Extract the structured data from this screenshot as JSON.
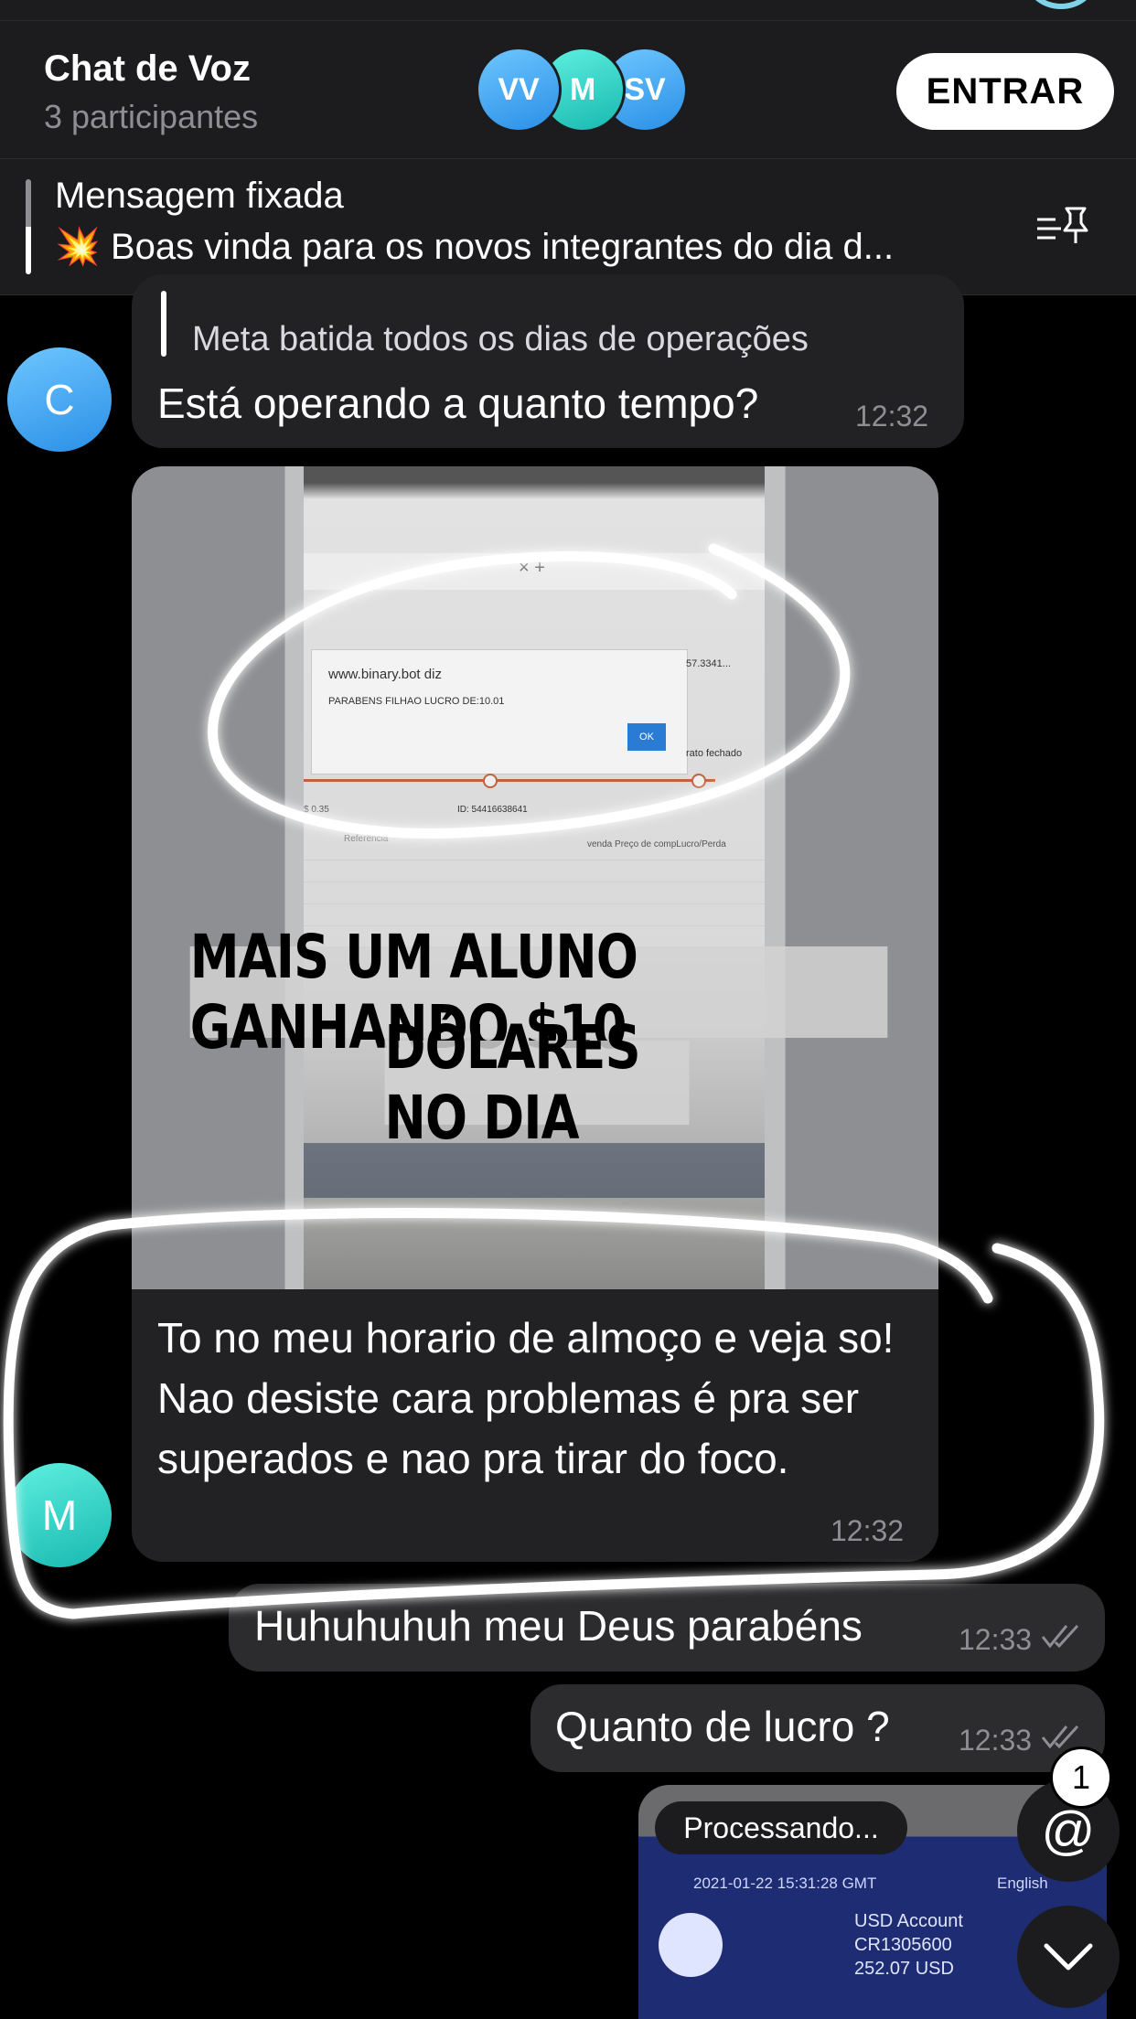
{
  "voice_chat": {
    "title": "Chat de Voz",
    "subtitle": "3 participantes",
    "participants": [
      "VV",
      "M",
      "SV"
    ],
    "join_label": "ENTRAR"
  },
  "pinned": {
    "title": "Mensagem fixada",
    "emoji": "💥",
    "text": "Boas vinda para os novos integrantes do dia d..."
  },
  "messages": [
    {
      "sender_initial": "C",
      "quote_text": "Meta batida todos os dias de operações",
      "text": "Está operando a quanto tempo?",
      "time": "12:32"
    },
    {
      "sender_initial": "M",
      "photo": {
        "dialog_site": "www.binary.bot diz",
        "dialog_message": "PARABENS FILHAO LUCRO DE:10.01",
        "dialog_ok": "OK",
        "side_value": "57.3341...",
        "side_label": "rato fechado",
        "id_text": "ID: 54416638641",
        "stake": "$ 0.35",
        "col_ref": "Referência",
        "col_header": "venda  Preço de compLucro/Perda",
        "banner_line1": "MAIS UM ALUNO GANHANDO $10",
        "banner_line2": "DÓLARES NO DIA"
      },
      "text": "To no meu horario de almoço e veja so! Nao desiste cara problemas é pra ser superados e nao pra tirar do foco.",
      "time": "12:32"
    },
    {
      "outgoing": true,
      "text": "Huhuhuhuh meu Deus parabéns",
      "time": "12:33"
    },
    {
      "outgoing": true,
      "text": "Quanto de lucro ?",
      "time": "12:33"
    }
  ],
  "preview": {
    "status": "Processando...",
    "date": "2021-01-22 15:31:28 GMT",
    "language": "English",
    "account": "USD Account",
    "account_id": "CR1305600",
    "balance": "252.07 USD"
  },
  "mention_badge": "1",
  "mention_symbol": "@",
  "colors": {
    "background": "#000000",
    "bubble": "#222224",
    "accent_blue": "#2a8fe6",
    "accent_teal": "#18b8b0"
  }
}
